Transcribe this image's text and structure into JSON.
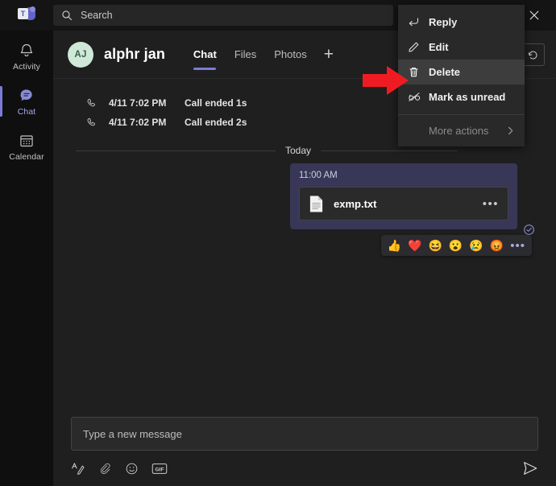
{
  "window": {
    "app_logo": "teams-logo",
    "logo_letter": "T",
    "close_label": "✕"
  },
  "search": {
    "placeholder": "Search",
    "icon": "search-icon"
  },
  "rail": {
    "items": [
      {
        "label": "Activity",
        "icon": "bell-icon",
        "active": false
      },
      {
        "label": "Chat",
        "icon": "chat-bubble-icon",
        "active": true
      },
      {
        "label": "Calendar",
        "icon": "calendar-icon",
        "active": false
      }
    ]
  },
  "chat_header": {
    "avatar_initials": "AJ",
    "title": "alphr jan",
    "tabs": [
      {
        "label": "Chat",
        "active": true
      },
      {
        "label": "Files",
        "active": false
      },
      {
        "label": "Photos",
        "active": false
      }
    ],
    "add_tab_label": "+"
  },
  "stream": {
    "calls": [
      {
        "icon": "call-icon",
        "time": "4/11 7:02 PM",
        "text": "Call ended 1s"
      },
      {
        "icon": "call-icon",
        "time": "4/11 7:02 PM",
        "text": "Call ended 2s"
      }
    ],
    "day_divider_label": "Today",
    "reactions": [
      {
        "name": "thumbs-up-reaction",
        "glyph": "👍"
      },
      {
        "name": "heart-reaction",
        "glyph": "❤️"
      },
      {
        "name": "laugh-reaction",
        "glyph": "😆"
      },
      {
        "name": "surprised-reaction",
        "glyph": "😮"
      },
      {
        "name": "sad-reaction",
        "glyph": "😢"
      },
      {
        "name": "angry-reaction",
        "glyph": "😡"
      }
    ],
    "reactions_more": "•••",
    "message": {
      "time": "11:00 AM",
      "file_name": "exmp.txt",
      "file_icon": "text-file-icon",
      "file_more": "•••",
      "seen_icon": "seen-check-icon"
    }
  },
  "context_menu": {
    "items": [
      {
        "label": "Reply",
        "icon": "reply-arrow-icon",
        "highlighted": false,
        "dimmed": false
      },
      {
        "label": "Edit",
        "icon": "pencil-icon",
        "highlighted": false,
        "dimmed": false
      },
      {
        "label": "Delete",
        "icon": "trash-icon",
        "highlighted": true,
        "dimmed": false
      },
      {
        "label": "Mark as unread",
        "icon": "glasses-crossed-icon",
        "highlighted": false,
        "dimmed": false
      }
    ],
    "more_actions": {
      "label": "More actions",
      "chevron": "›",
      "dimmed": true
    }
  },
  "annotation": {
    "arrow": "red-arrow-pointing-right",
    "color": "#ee1c22"
  },
  "compose": {
    "placeholder": "Type a new message",
    "tools": [
      {
        "name": "format-text-icon"
      },
      {
        "name": "attach-clip-icon"
      },
      {
        "name": "emoji-icon"
      },
      {
        "name": "gif-icon",
        "label": "GIF"
      }
    ],
    "send_icon": "send-icon"
  },
  "colors": {
    "accent_purple": "#7b7cd6",
    "bubble": "#383757",
    "app_bg": "#141414",
    "main_bg": "#1f1f1f",
    "menu_bg": "#292929",
    "arrow_red": "#ee1c22"
  }
}
